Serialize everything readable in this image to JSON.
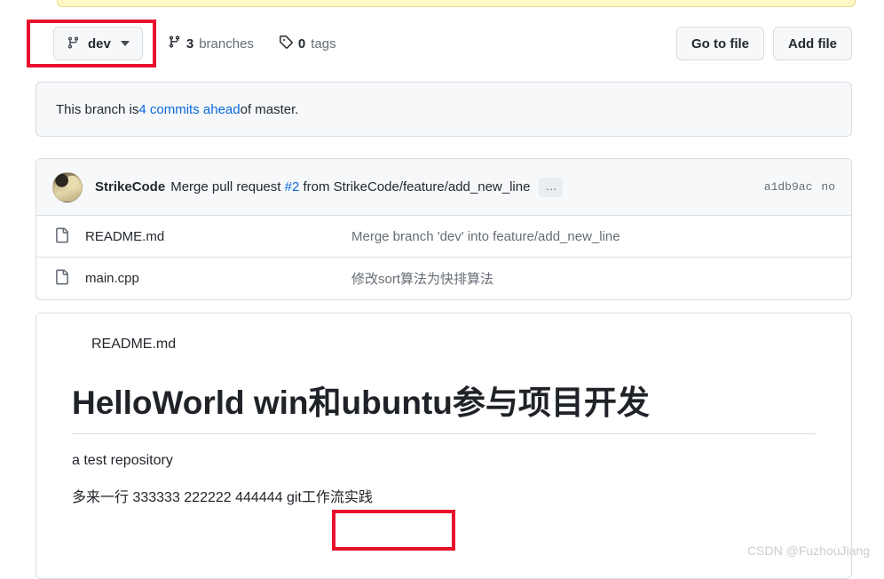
{
  "notice_bar": {
    "present": true,
    "background": "#fff8c5"
  },
  "toolbar": {
    "branch_icon": "git-branch-icon",
    "branch_name": "dev",
    "branches_count": "3",
    "branches_label": "branches",
    "branches_icon": "git-branch-icon",
    "tags_count": "0",
    "tags_label": "tags",
    "tags_icon": "tag-icon",
    "go_to_file_label": "Go to file",
    "add_file_label": "Add file"
  },
  "branch_status": {
    "prefix": "This branch is ",
    "link": "4 commits ahead",
    "suffix": " of master."
  },
  "commit_header": {
    "author": "StrikeCode",
    "message_prefix": "Merge pull request ",
    "pr_number": "#2",
    "message_suffix": " from StrikeCode/feature/add_new_line",
    "expand_label": "…",
    "sha": "a1db9ac",
    "time": "no"
  },
  "files": [
    {
      "icon": "file-icon",
      "name": "README.md",
      "commit_message": "Merge branch 'dev' into feature/add_new_line"
    },
    {
      "icon": "file-icon",
      "name": "main.cpp",
      "commit_message": "修改sort算法为快排算法"
    }
  ],
  "readme": {
    "title": "README.md",
    "heading": "HelloWorld win和ubuntu参与项目开发",
    "paragraph_1": "a test repository",
    "paragraph_2_plain": "多来一行 333333 222222 444444 ",
    "paragraph_2_boxed": "git工作流实践"
  },
  "annotations": {
    "color": "#e8112d",
    "box_1_target": "branch-selector",
    "box_2_target": "readme-git-workflow-text"
  },
  "watermark": {
    "text": "CSDN @FuzhouJiang"
  }
}
